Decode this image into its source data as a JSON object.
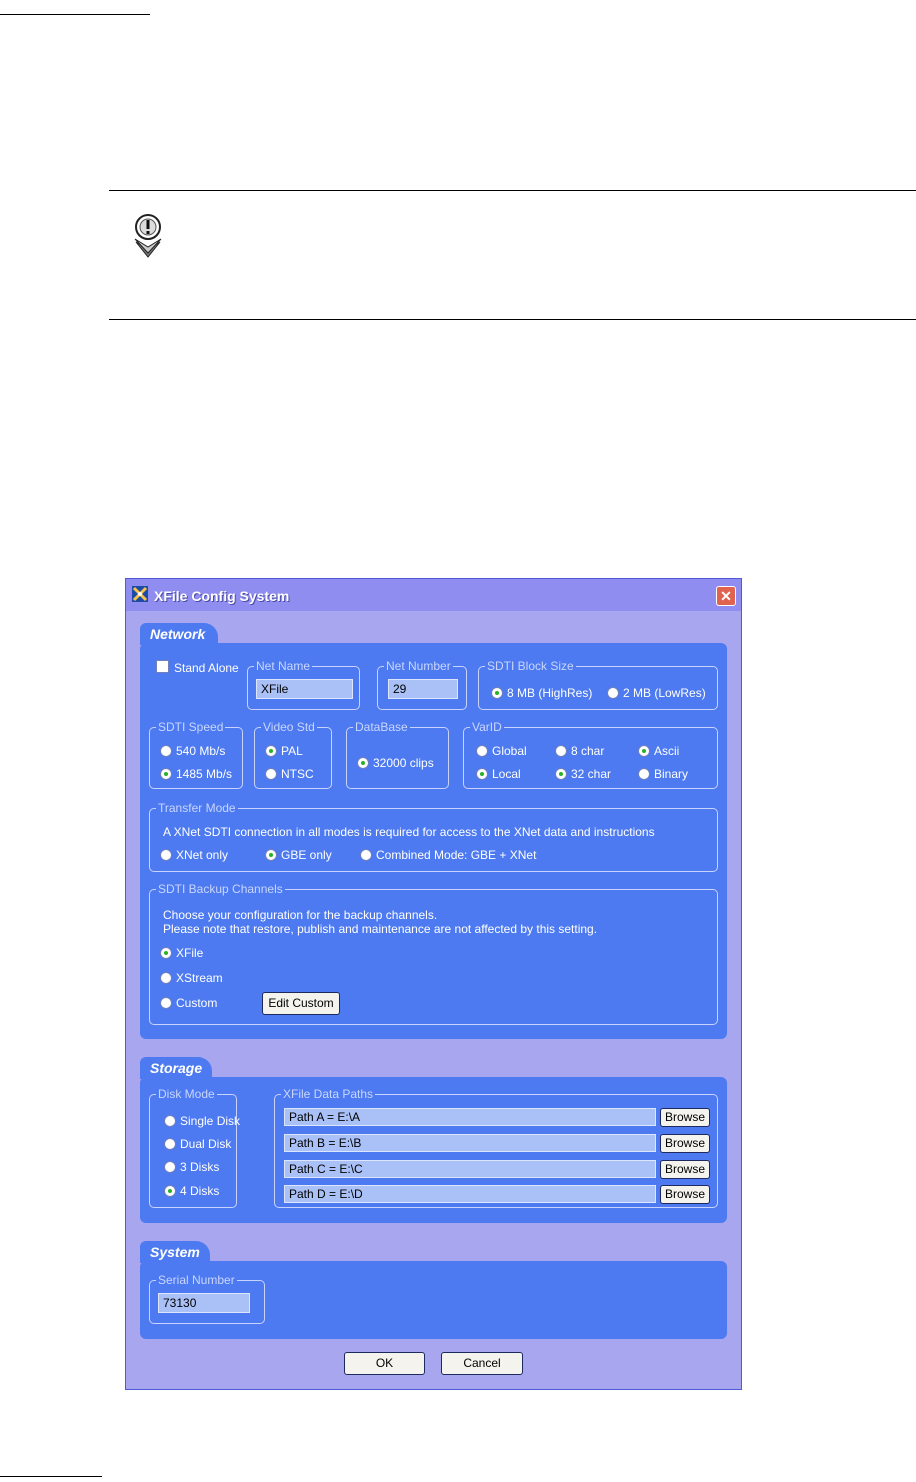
{
  "window": {
    "title": "XFile Config System",
    "close_glyph": "✕"
  },
  "network": {
    "tab": "Network",
    "stand_alone": "Stand Alone",
    "net_name": {
      "legend": "Net Name",
      "value": "XFile"
    },
    "net_number": {
      "legend": "Net Number",
      "value": "29"
    },
    "sdti_block_size": {
      "legend": "SDTI Block Size",
      "options": [
        "8 MB (HighRes)",
        "2 MB (LowRes)"
      ],
      "selected": "8 MB (HighRes)"
    },
    "sdti_speed": {
      "legend": "SDTI Speed",
      "options": [
        "540 Mb/s",
        "1485 Mb/s"
      ],
      "selected": "1485 Mb/s"
    },
    "video_std": {
      "legend": "Video Std",
      "options": [
        "PAL",
        "NTSC"
      ],
      "selected": "PAL"
    },
    "database": {
      "legend": "DataBase",
      "options": [
        "32000 clips"
      ],
      "selected": "32000 clips"
    },
    "varid": {
      "legend": "VarID",
      "options": [
        "Global",
        "8 char",
        "Ascii",
        "Local",
        "32 char",
        "Binary"
      ],
      "selected": [
        "Ascii",
        "Local",
        "32 char"
      ]
    },
    "transfer_mode": {
      "legend": "Transfer Mode",
      "note": "A XNet SDTI connection in all modes is required for access to the XNet data and instructions",
      "options": [
        "XNet only",
        "GBE only",
        "Combined Mode: GBE + XNet"
      ],
      "selected": "GBE only"
    },
    "backup": {
      "legend": "SDTI Backup Channels",
      "line1": "Choose your configuration for the backup channels.",
      "line2": "Please note that restore, publish and maintenance are not affected by this setting.",
      "options": [
        "XFile",
        "XStream",
        "Custom"
      ],
      "selected": "XFile",
      "edit_custom": "Edit Custom"
    }
  },
  "storage": {
    "tab": "Storage",
    "disk_mode": {
      "legend": "Disk Mode",
      "options": [
        "Single Disk",
        "Dual Disk",
        "3 Disks",
        "4 Disks"
      ],
      "selected": "4 Disks"
    },
    "data_paths": {
      "legend": "XFile Data Paths",
      "paths": [
        "Path A = E:\\A",
        "Path B = E:\\B",
        "Path C = E:\\C",
        "Path D = E:\\D"
      ],
      "browse": "Browse"
    }
  },
  "system": {
    "tab": "System",
    "serial": {
      "legend": "Serial Number",
      "value": "73130"
    }
  },
  "buttons": {
    "ok": "OK",
    "cancel": "Cancel"
  },
  "colors": {
    "panel": "#4d7af0",
    "dialog_bg": "#a8a6ee",
    "titlebar": "#8f8df0",
    "close": "#e0634f",
    "field": "#a9c1f7"
  },
  "icons": {
    "note": "warning-disc-icon",
    "app": "xfile-app-icon"
  }
}
